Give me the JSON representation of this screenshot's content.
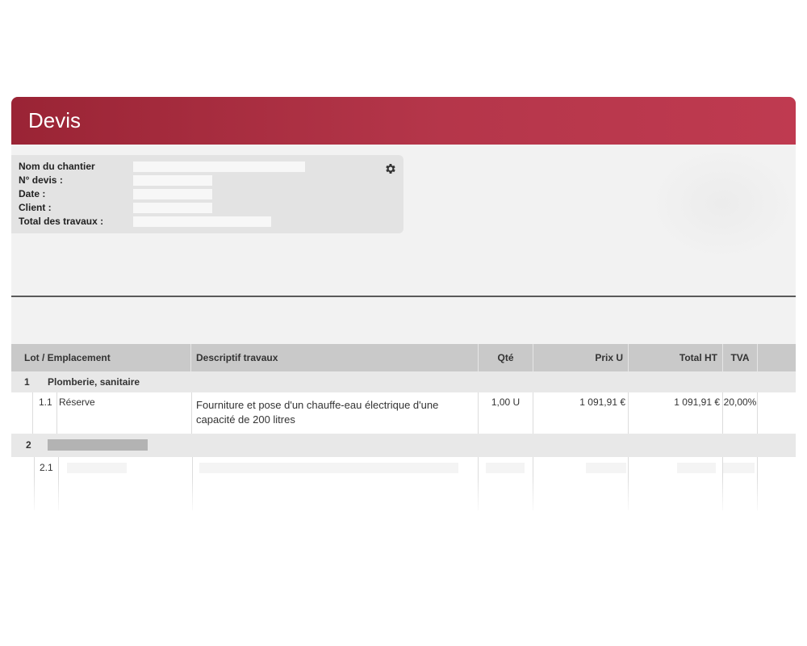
{
  "header": {
    "title": "Devis"
  },
  "info": {
    "labels": {
      "site_name": "Nom du chantier",
      "quote_no": "N° devis :",
      "date": "Date :",
      "client": "Client :",
      "total_works": "Total des travaux :"
    },
    "icon": "gear-icon"
  },
  "table": {
    "columns": {
      "lot": "Lot / Emplacement",
      "description": "Descriptif travaux",
      "qty": "Qté",
      "unit_price": "Prix U",
      "total_ht": "Total HT",
      "vat": "TVA"
    },
    "lots": [
      {
        "number": "1",
        "name": "Plomberie, sanitaire",
        "items": [
          {
            "number": "1.1",
            "location": "Réserve",
            "description": "Fourniture et pose d'un chauffe-eau électrique d'une capacité de 200 litres",
            "qty": "1,00 U",
            "unit_price": "1 091,91 €",
            "total_ht": "1 091,91 €",
            "vat": "20,00%"
          }
        ]
      },
      {
        "number": "2",
        "items": [
          {
            "number": "2.1"
          }
        ]
      }
    ]
  },
  "colors": {
    "header_start": "#9a2435",
    "header_end": "#bf3a50"
  }
}
